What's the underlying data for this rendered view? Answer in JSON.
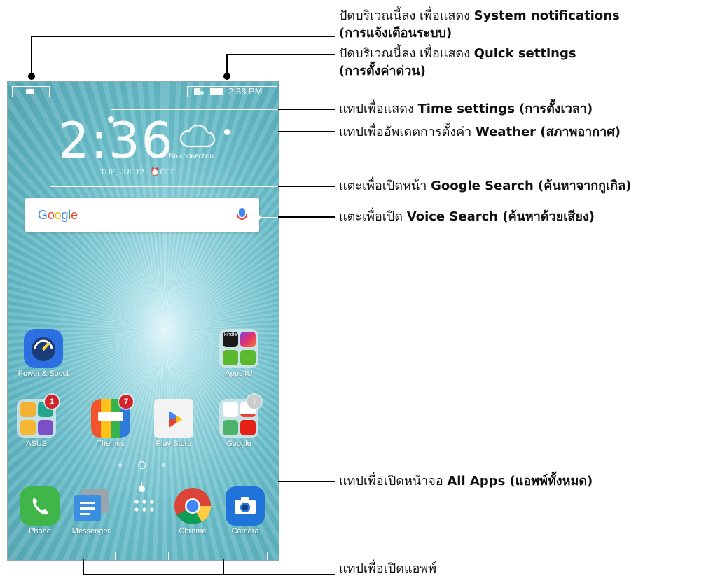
{
  "status_bar": {
    "time": "2:36 PM"
  },
  "clock": {
    "time": "2:36",
    "date": "TUE, JUL 12",
    "alarm": "OFF"
  },
  "weather": {
    "status": "No connection",
    "icon": "cloud-icon"
  },
  "search": {
    "logo": "Google",
    "icon": "mic-icon"
  },
  "apps_row1": [
    {
      "label": "Power & Boost"
    },
    {
      "label": "Apps4U",
      "mini_label": "kindle"
    }
  ],
  "apps_row2": [
    {
      "label": "ASUS",
      "badge": "1"
    },
    {
      "label": "Themes",
      "badge": "7"
    },
    {
      "label": "Play Store"
    },
    {
      "label": "Google",
      "badge": "!"
    }
  ],
  "dock": [
    {
      "label": "Phone"
    },
    {
      "label": "Messenger"
    },
    {
      "label": "Chrome"
    },
    {
      "label": "Camera"
    }
  ],
  "callouts": [
    {
      "prefix": "ปัดบริเวณนี้ลง เพื่อแสดง ",
      "bold": "System notifications",
      "line2": "(การแจ้งเตือนระบบ)"
    },
    {
      "prefix": "ปัดบริเวณนี้ลง เพื่อแสดง ",
      "bold": "Quick settings",
      "line2": "(การตั้งค่าด่วน)"
    },
    {
      "prefix": "แทปเพื่อแสดง ",
      "bold": "Time settings (การตั้งเวลา)"
    },
    {
      "prefix": "แทปเพื่ออัพเดตการตั้งค่า ",
      "bold": "Weather (สภาพอากาศ)"
    },
    {
      "prefix": "แตะเพื่อเปิดหน้า ",
      "bold": "Google Search (ค้นหาจากกูเกิล)"
    },
    {
      "prefix": "แตะเพื่อเปิด ",
      "bold": "Voice Search (ค้นหาด้วยเสียง)"
    },
    {
      "prefix": "แทปเพื่อเปิดหน้าจอ ",
      "bold": "All Apps (แอพพ์ทั้งหมด)"
    },
    {
      "prefix": "แทปเพื่อเปิดแอพพ์"
    }
  ],
  "colors": {
    "google_blue": "#4285F4",
    "google_red": "#EA4335",
    "google_yellow": "#FBBC05",
    "google_green": "#34A853",
    "badge_red": "#d6232b"
  }
}
